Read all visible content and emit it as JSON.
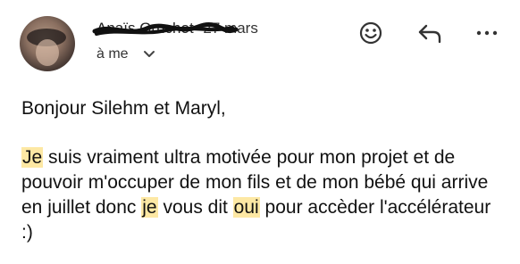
{
  "header": {
    "sender_name": "Anaïs Gruchot",
    "date": "27 mars",
    "recipient": "à me"
  },
  "icons": {
    "avatar": "avatar",
    "emoji": "emoji-icon",
    "reply": "reply-icon",
    "more": "more-icon",
    "chevron": "chevron-down-icon"
  },
  "body": {
    "greeting": "Bonjour Silehm et Maryl,",
    "paragraph": [
      {
        "text": "Je",
        "highlight": true
      },
      {
        "text": " suis vraiment ultra motivée pour mon projet et de pouvoir m'occuper de mon fils et de mon bébé qui arrive en juillet donc ",
        "highlight": false
      },
      {
        "text": "je",
        "highlight": true
      },
      {
        "text": " vous dit ",
        "highlight": false
      },
      {
        "text": "oui",
        "highlight": true
      },
      {
        "text": " pour accèder l'accélérateur :)",
        "highlight": false
      }
    ]
  },
  "colors": {
    "highlight": "#fde8a4",
    "text": "#111111"
  }
}
